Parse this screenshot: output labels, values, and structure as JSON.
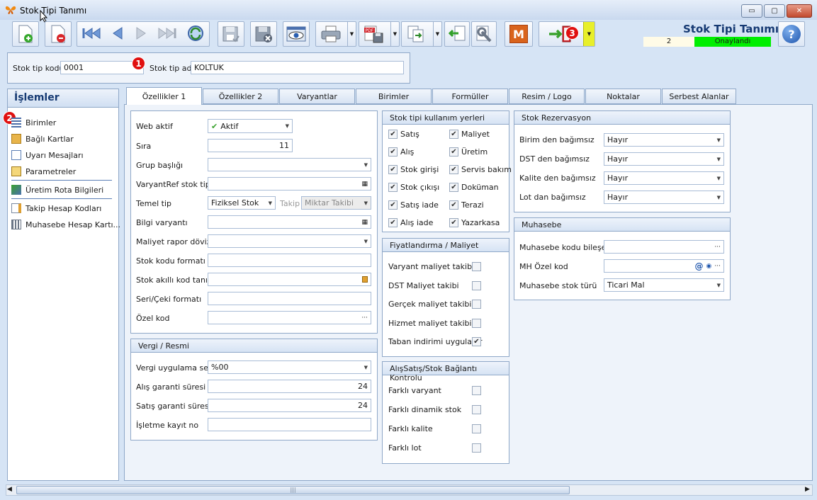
{
  "window": {
    "title": "Stok Tipi Tanımı",
    "min": "▭",
    "max": "▢",
    "close": "✕"
  },
  "header": {
    "title": "Stok Tipi Tanımı",
    "record_no": "2",
    "status": "Onaylandı",
    "status_color": "#00ee00"
  },
  "toolbar": {
    "m_label": "M",
    "help": "?"
  },
  "form": {
    "kod_label": "Stok tip kodu",
    "kod_value": "0001",
    "ad_label": "Stok tip adı",
    "ad_value": "KOLTUK"
  },
  "badges": {
    "b1": "1",
    "b2": "2",
    "b3": "3"
  },
  "sidebar": {
    "title": "İşlemler",
    "items": [
      {
        "label": "Birimler",
        "icon": "grid-icon"
      },
      {
        "label": "Bağlı Kartlar",
        "icon": "folder-icon"
      },
      {
        "label": "Uyarı Mesajları",
        "icon": "message-icon"
      },
      {
        "label": "Parametreler",
        "icon": "clipboard-icon"
      },
      {
        "label": "Üretim Rota Bilgileri",
        "icon": "route-icon"
      },
      {
        "label": "Takip Hesap Kodları",
        "icon": "edit-icon"
      },
      {
        "label": "Muhasebe Hesap Kartı...",
        "icon": "ledger-icon"
      }
    ]
  },
  "tabs": [
    "Özellikler 1",
    "Özellikler 2",
    "Varyantlar",
    "Birimler",
    "Formüller",
    "Resim / Logo",
    "Noktalar",
    "Serbest Alanlar"
  ],
  "props": {
    "web_label": "Web aktif",
    "web_value": "Aktif",
    "sira_label": "Sıra",
    "sira_value": "11",
    "grup_label": "Grup başlığı",
    "varyantref_label": "VaryantRef stok tipi",
    "temel_label": "Temel tip",
    "temel_value": "Fiziksel Stok",
    "takip_label": "Takip",
    "takip_value": "Miktar Takibi",
    "bilgi_label": "Bilgi varyantı",
    "maliyet_label": "Maliyet rapor dövizi",
    "stokkodu_label": "Stok kodu formatı",
    "akilli_label": "Stok akıllı kod tanımı",
    "seri_label": "Seri/Çeki formatı",
    "ozel_label": "Özel kod"
  },
  "vergi": {
    "title": "Vergi / Resmi",
    "seti_label": "Vergi uygulama seti",
    "seti_value": "%00",
    "alis_label": "Alış garanti süresi",
    "alis_value": "24",
    "satis_label": "Satış garanti süresi",
    "satis_value": "24",
    "isletme_label": "İşletme kayıt no"
  },
  "kullanim": {
    "title": "Stok tipi kullanım yerleri",
    "items": [
      {
        "label": "Satış",
        "checked": true
      },
      {
        "label": "Maliyet",
        "checked": true
      },
      {
        "label": "Alış",
        "checked": true
      },
      {
        "label": "Üretim",
        "checked": true
      },
      {
        "label": "Stok girişi",
        "checked": true
      },
      {
        "label": "Servis bakım",
        "checked": true
      },
      {
        "label": "Stok çıkışı",
        "checked": true
      },
      {
        "label": "Doküman",
        "checked": true
      },
      {
        "label": "Satış iade",
        "checked": true
      },
      {
        "label": "Terazi",
        "checked": true
      },
      {
        "label": "Alış iade",
        "checked": true
      },
      {
        "label": "Yazarkasa",
        "checked": true
      }
    ]
  },
  "fiyat": {
    "title": "Fiyatlandırma / Maliyet",
    "items": [
      {
        "label": "Varyant maliyet takibi",
        "checked": false
      },
      {
        "label": "DST Maliyet takibi",
        "checked": false
      },
      {
        "label": "Gerçek maliyet takibi",
        "checked": false
      },
      {
        "label": "Hizmet maliyet takibi",
        "checked": false
      },
      {
        "label": "Taban indirimi uygulanır",
        "checked": true
      }
    ]
  },
  "kontrol": {
    "title": "AlışSatış/Stok Bağlantı Kontrolu",
    "items": [
      {
        "label": "Farklı varyant",
        "checked": false
      },
      {
        "label": "Farklı dinamik stok",
        "checked": false
      },
      {
        "label": "Farklı kalite",
        "checked": false
      },
      {
        "label": "Farklı lot",
        "checked": false
      }
    ]
  },
  "rezervasyon": {
    "title": "Stok Rezervasyon",
    "items": [
      {
        "label": "Birim den bağımsız",
        "value": "Hayır"
      },
      {
        "label": "DST den bağımsız",
        "value": "Hayır"
      },
      {
        "label": "Kalite den bağımsız",
        "value": "Hayır"
      },
      {
        "label": "Lot dan bağımsız",
        "value": "Hayır"
      }
    ]
  },
  "muhasebe": {
    "title": "Muhasebe",
    "kod_label": "Muhasebe kodu bileşeni",
    "ozel_label": "MH Özel kod",
    "tur_label": "Muhasebe stok türü",
    "tur_value": "Ticari Mal"
  }
}
